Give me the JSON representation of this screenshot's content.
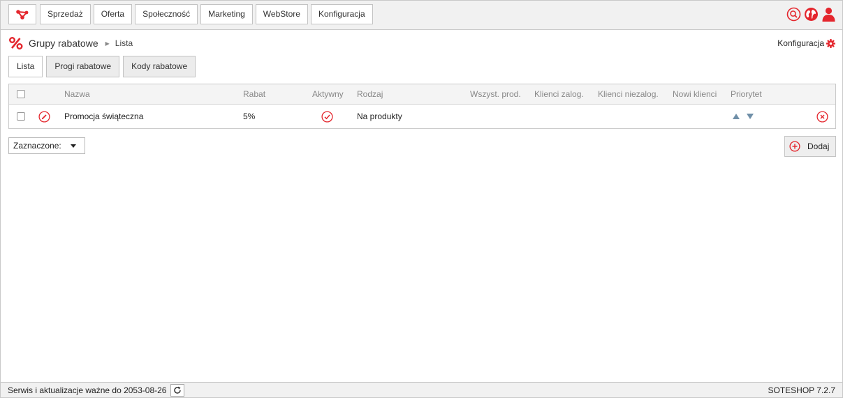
{
  "nav": {
    "items": [
      {
        "id": "sprzedaz",
        "label": "Sprzedaż"
      },
      {
        "id": "oferta",
        "label": "Oferta"
      },
      {
        "id": "spolecznosc",
        "label": "Społeczność"
      },
      {
        "id": "marketing",
        "label": "Marketing"
      },
      {
        "id": "webstore",
        "label": "WebStore"
      },
      {
        "id": "konfiguracja",
        "label": "Konfiguracja"
      }
    ],
    "icons": [
      "search-icon",
      "globe-icon",
      "user-icon"
    ]
  },
  "breadcrumb": {
    "section": "Grupy rabatowe",
    "current": "Lista"
  },
  "config_link": {
    "label": "Konfiguracja"
  },
  "tabs": [
    {
      "label": "Lista",
      "active": true
    },
    {
      "label": "Progi rabatowe",
      "active": false
    },
    {
      "label": "Kody rabatowe",
      "active": false
    }
  ],
  "table": {
    "columns": {
      "name": "Nazwa",
      "discount": "Rabat",
      "active": "Aktywny",
      "type": "Rodzaj",
      "all_products": "Wszyst. prod.",
      "logged_clients": "Klienci zalog.",
      "guest_clients": "Klienci niezalog.",
      "new_clients": "Nowi klienci",
      "priority": "Priorytet"
    },
    "rows": [
      {
        "name": "Promocja świąteczna",
        "discount": "5%",
        "active": true,
        "type": "Na produkty"
      }
    ]
  },
  "selected_dropdown": {
    "label": "Zaznaczone:"
  },
  "add_button": {
    "label": "Dodaj"
  },
  "footer": {
    "status": "Serwis i aktualizacje ważne do 2053-08-26",
    "version": "SOTESHOP 7.2.7"
  },
  "colors": {
    "accent": "#e4262d",
    "priority_arrows": "#6f8fa8",
    "muted_text": "#888888"
  }
}
